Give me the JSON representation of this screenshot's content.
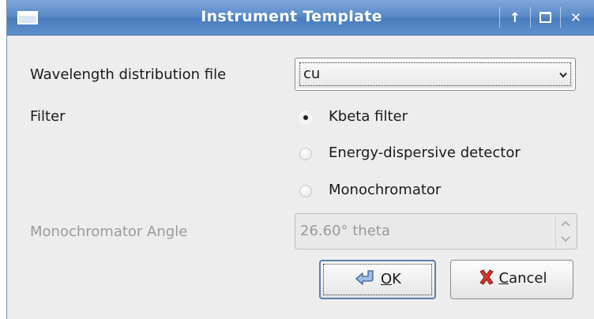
{
  "window": {
    "title": "Instrument Template",
    "buttons": [
      "↑",
      "□",
      "✕"
    ]
  },
  "form": {
    "wavelength_label": "Wavelength distribution file",
    "wavelength_value": "cu",
    "filter_label": "Filter",
    "filter_options": [
      {
        "label": "Kbeta filter",
        "checked": true
      },
      {
        "label": "Energy-dispersive detector",
        "checked": false
      },
      {
        "label": "Monochromator",
        "checked": false
      }
    ],
    "angle_label": "Monochromator Angle",
    "angle_value": "26.60° theta"
  },
  "buttons": {
    "ok_mnemonic": "O",
    "ok_rest": "K",
    "cancel_mnemonic": "C",
    "cancel_rest": "ancel"
  },
  "icons": {
    "ok": "return-arrow-icon",
    "cancel": "red-x-icon",
    "combo": "chevron-down-icon"
  }
}
